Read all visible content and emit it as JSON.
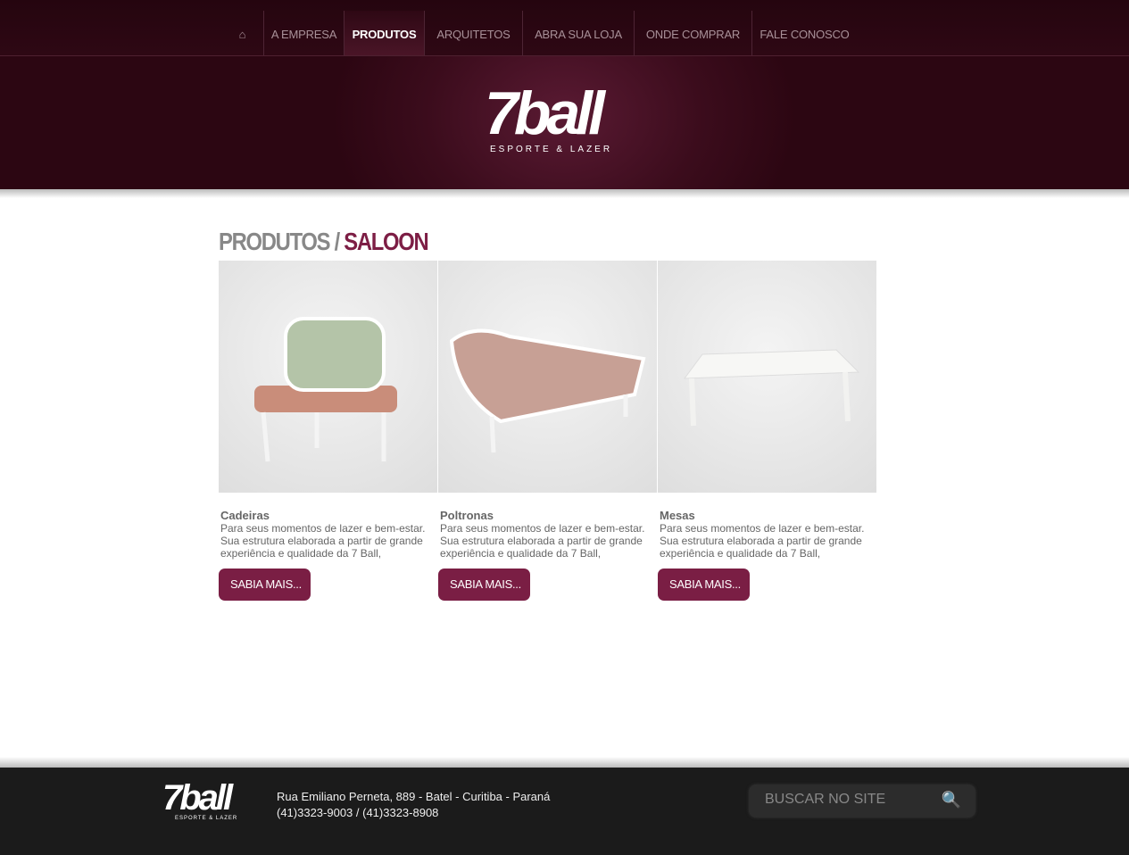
{
  "nav": {
    "items": [
      {
        "label": "⌂"
      },
      {
        "label": "A EMPRESA"
      },
      {
        "label": "PRODUTOS",
        "active": true
      },
      {
        "label": "ARQUITETOS"
      },
      {
        "label": "ABRA SUA LOJA"
      },
      {
        "label": "ONDE COMPRAR"
      },
      {
        "label": "FALE CONOSCO"
      }
    ]
  },
  "logo": {
    "text": "7ball",
    "subtitle": "ESPORTE & LAZER"
  },
  "page": {
    "title": "PRODUTOS /",
    "subtitle": "SALOON"
  },
  "products": [
    {
      "name": "Cadeiras",
      "desc": "Para seus momentos de lazer e bem-estar. Sua estrutura elaborada a partir de grande experiência e qualidade da 7 Ball,",
      "button": "SABIA MAIS..."
    },
    {
      "name": "Poltronas",
      "desc": "Para seus momentos de lazer e bem-estar. Sua estrutura elaborada a partir de grande experiência e qualidade da 7 Ball,",
      "button": "SABIA MAIS..."
    },
    {
      "name": "Mesas",
      "desc": "Para seus momentos de lazer e bem-estar. Sua estrutura elaborada a partir de grande experiência e qualidade da 7 Ball,",
      "button": "SABIA MAIS..."
    }
  ],
  "footer": {
    "address": "Rua Emiliano Perneta, 889 - Batel - Curitiba - Paraná",
    "phones": "(41)3323-9003 / (41)3323-8908",
    "search_placeholder": "BUSCAR NO SITE"
  }
}
